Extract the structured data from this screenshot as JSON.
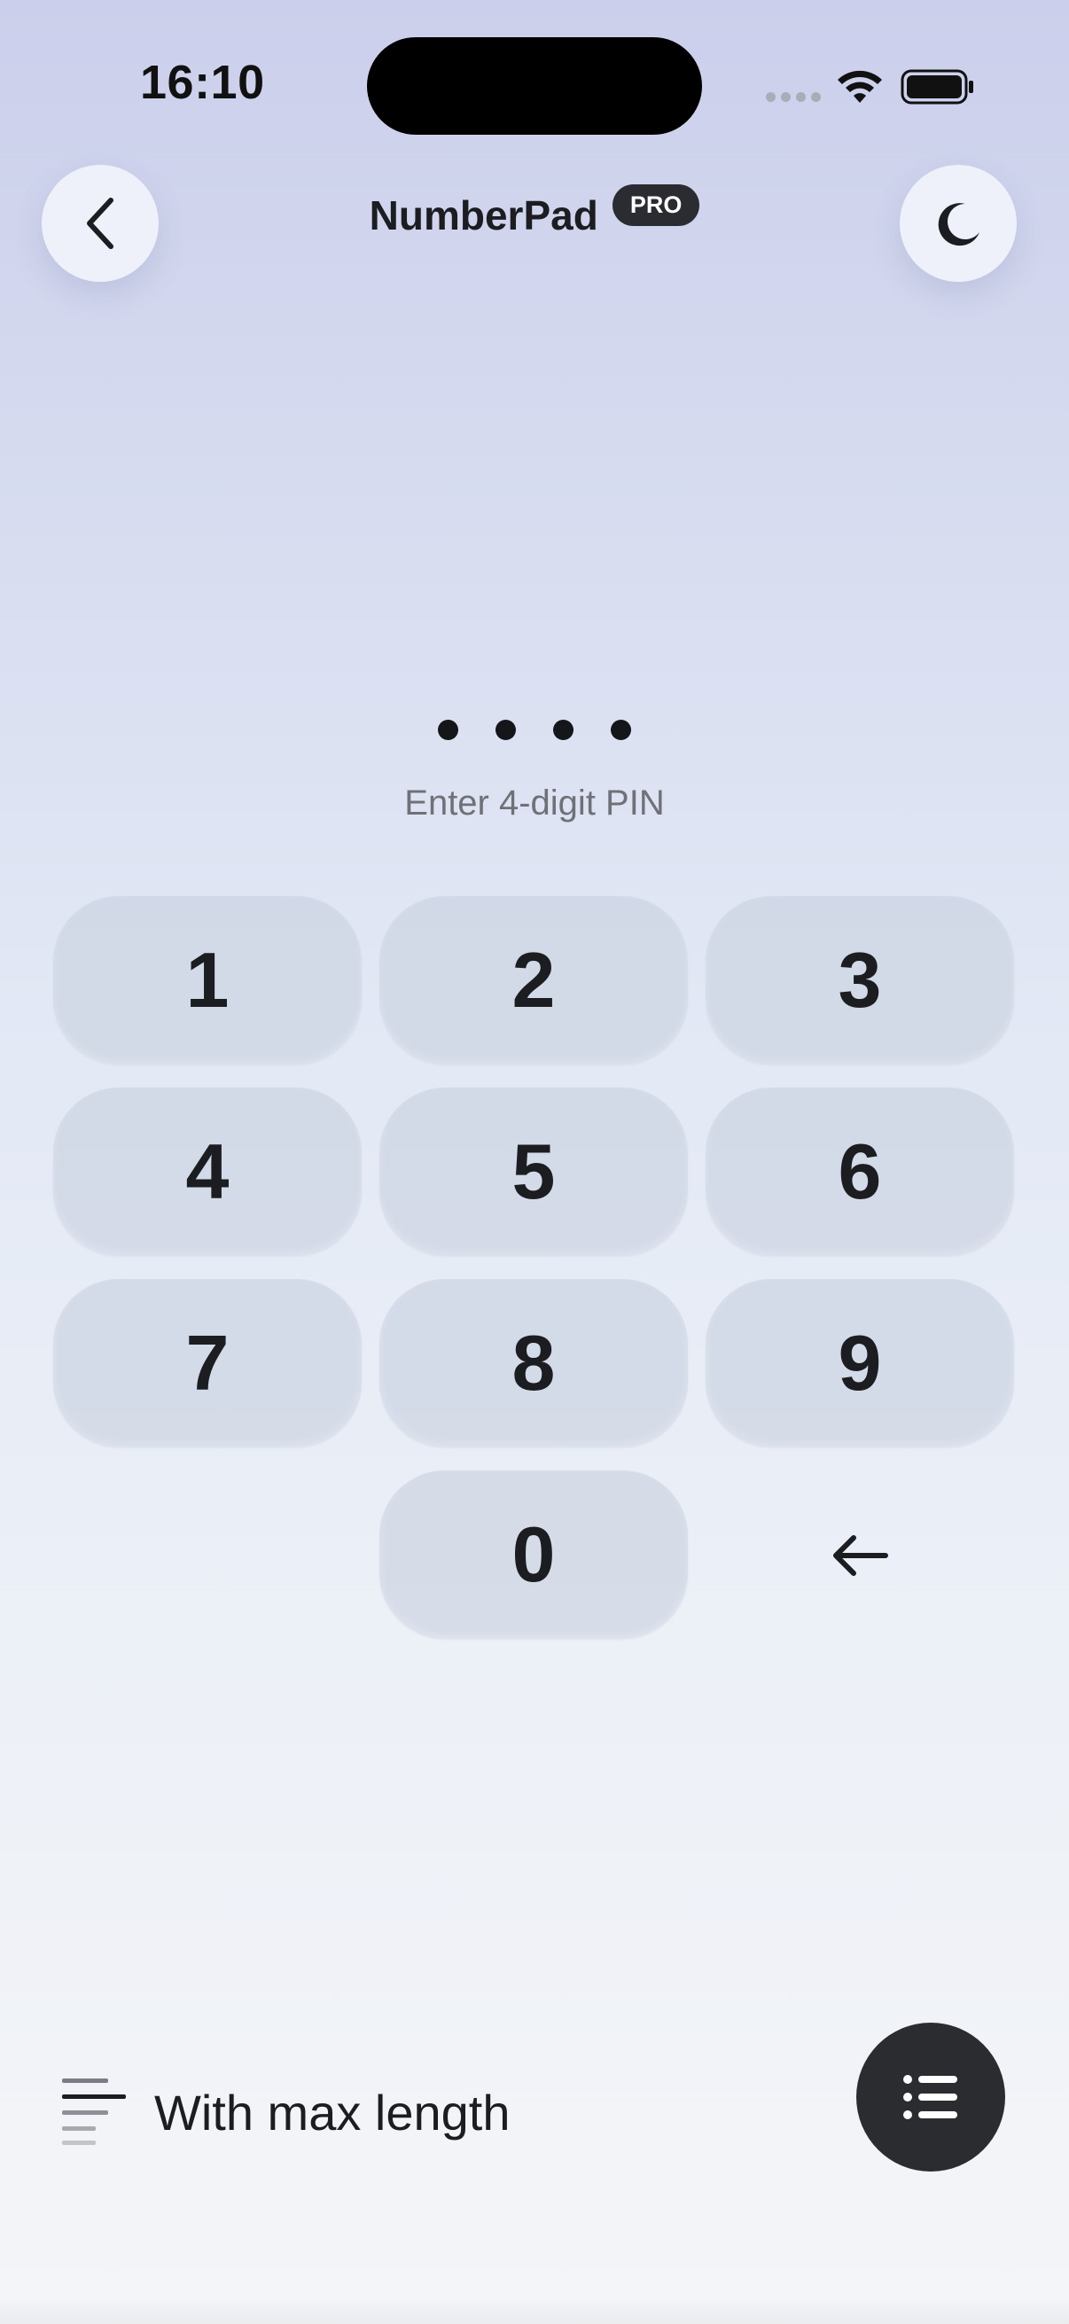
{
  "status_bar": {
    "time": "16:10"
  },
  "header": {
    "title": "NumberPad",
    "badge": "PRO",
    "back_icon": "chevron-left-icon",
    "theme_icon": "moon-icon"
  },
  "pin": {
    "dots_filled": 4,
    "prompt": "Enter 4-digit PIN"
  },
  "keypad": {
    "keys": [
      "1",
      "2",
      "3",
      "4",
      "5",
      "6",
      "7",
      "8",
      "9",
      "0"
    ],
    "backspace_icon": "arrow-left-icon"
  },
  "footer": {
    "mode_label": "With max length",
    "mode_icon": "lines-icon",
    "menu_icon": "list-icon"
  },
  "colors": {
    "background_top": "#cbcfeb",
    "background_bottom": "#f4f5f8",
    "dark": "#2a2c30",
    "key_bg": "#c8d0de"
  }
}
